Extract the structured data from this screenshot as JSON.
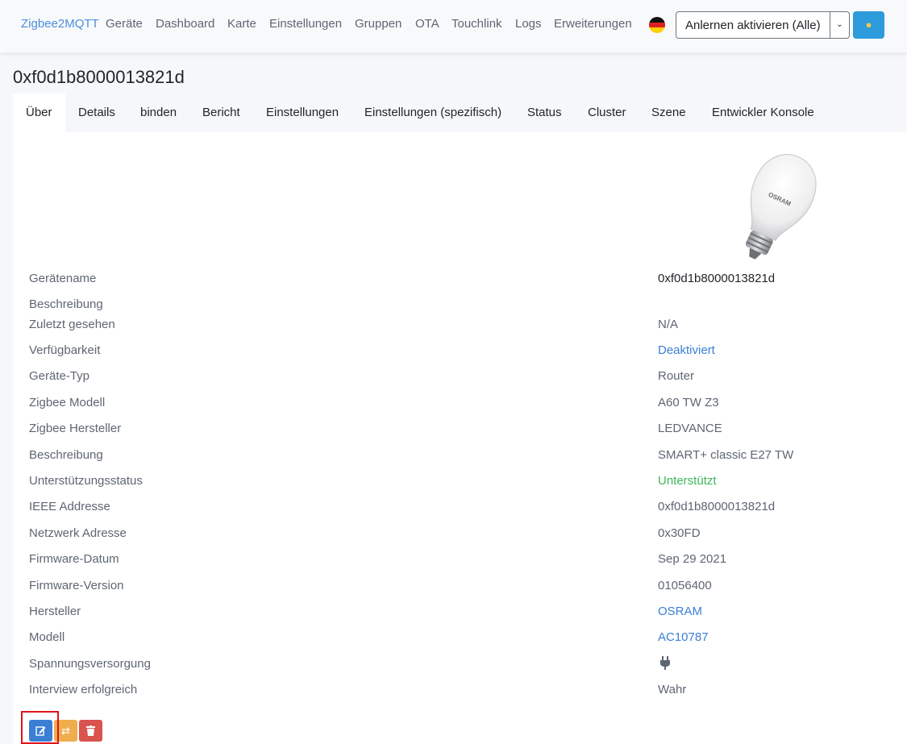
{
  "nav": {
    "brand": "Zigbee2MQTT",
    "items": [
      "Geräte",
      "Dashboard",
      "Karte",
      "Einstellungen",
      "Gruppen",
      "OTA",
      "Touchlink",
      "Logs",
      "Erweiterungen"
    ],
    "join_button": "Anlernen aktivieren (Alle)",
    "theme_icon": "moon-face-icon"
  },
  "device": {
    "title": "0xf0d1b8000013821d",
    "image": "osram-bulb-image"
  },
  "tabs": [
    "Über",
    "Details",
    "binden",
    "Bericht",
    "Einstellungen",
    "Einstellungen (spezifisch)",
    "Status",
    "Cluster",
    "Szene",
    "Entwickler Konsole"
  ],
  "tab_active": "Über",
  "info": [
    {
      "label": "Gerätename",
      "value": "0xf0d1b8000013821d",
      "style": "dark"
    },
    {
      "label": "Beschreibung",
      "value": "",
      "style": "plain"
    },
    {
      "label": "Zuletzt gesehen",
      "value": "N/A",
      "style": "plain"
    },
    {
      "label": "Verfügbarkeit",
      "value": "Deaktiviert",
      "style": "link"
    },
    {
      "label": "Geräte-Typ",
      "value": "Router",
      "style": "plain"
    },
    {
      "label": "Zigbee Modell",
      "value": "A60 TW Z3",
      "style": "plain"
    },
    {
      "label": "Zigbee Hersteller",
      "value": "LEDVANCE",
      "style": "plain"
    },
    {
      "label": "Beschreibung",
      "value": "SMART+ classic E27 TW",
      "style": "plain"
    },
    {
      "label": "Unterstützungsstatus",
      "value": "Unterstützt",
      "style": "ok"
    },
    {
      "label": "IEEE Addresse",
      "value": "0xf0d1b8000013821d",
      "style": "plain"
    },
    {
      "label": "Netzwerk Adresse",
      "value": "0x30FD",
      "style": "plain"
    },
    {
      "label": "Firmware-Datum",
      "value": "Sep 29 2021",
      "style": "plain"
    },
    {
      "label": "Firmware-Version",
      "value": "01056400",
      "style": "plain"
    },
    {
      "label": "Hersteller",
      "value": "OSRAM",
      "style": "link"
    },
    {
      "label": "Modell",
      "value": "AC10787",
      "style": "link"
    },
    {
      "label": "Spannungsversorgung",
      "value": "",
      "icon": "plug-icon",
      "style": "plain"
    },
    {
      "label": "Interview erfolgreich",
      "value": "Wahr",
      "style": "plain"
    }
  ],
  "actions": [
    {
      "name": "edit",
      "icon": "edit-icon",
      "color": "#3a7fd4"
    },
    {
      "name": "reconfigure",
      "icon": "refresh-icon",
      "color": "#f0ad4e"
    },
    {
      "name": "remove",
      "icon": "trash-icon",
      "color": "#d9534f"
    }
  ],
  "colors": {
    "brand": "#4a8fdb",
    "link": "#3a7fd4",
    "success": "#3fb65b",
    "highlight": "#e0141c"
  }
}
